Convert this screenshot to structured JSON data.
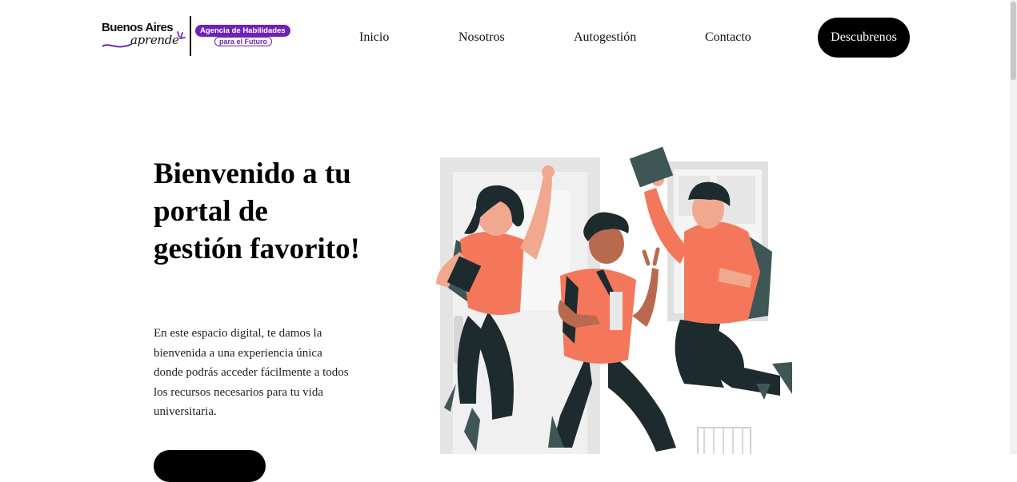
{
  "brand": {
    "name_line1": "Buenos Aires",
    "name_line2": "aprende",
    "badge_line1": "Agencia de Habilidades",
    "badge_line2": "para el Futuro",
    "accent_color": "#6e22b8"
  },
  "nav": {
    "items": [
      {
        "label": "Inicio"
      },
      {
        "label": "Nosotros"
      },
      {
        "label": "Autogestión"
      },
      {
        "label": "Contacto"
      }
    ],
    "cta_label": "Descubrenos"
  },
  "hero": {
    "title": "Bienvenido a tu portal de gestión favorito!",
    "text": "En este espacio digital, te damos la bienvenida a una experiencia única donde podrás acceder fácilmente a todos los recursos necesarios para tu vida universitaria.",
    "illustration": "three-students-jumping-illustration"
  },
  "colors": {
    "shirt": "#f4775b",
    "dark": "#1d2b2e",
    "background_gray": "#e4e4e4",
    "cta": "#000000"
  }
}
